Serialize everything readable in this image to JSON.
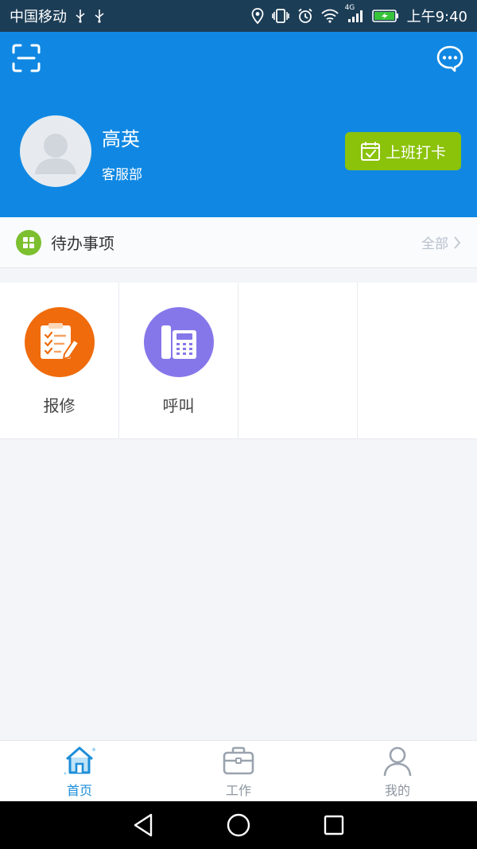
{
  "status_bar": {
    "carrier": "中国移动",
    "time": "上午9:40",
    "network_label": "4G"
  },
  "header": {
    "user_name": "高英",
    "department": "客服部",
    "clock_in_label": "上班打卡"
  },
  "todo": {
    "title": "待办事项",
    "all_label": "全部"
  },
  "grid": {
    "items": [
      {
        "label": "报修",
        "icon": "repair-clipboard-icon",
        "color": "#ef6b0c"
      },
      {
        "label": "呼叫",
        "icon": "telephone-icon",
        "color": "#8577ea"
      }
    ]
  },
  "tabbar": {
    "items": [
      {
        "label": "首页",
        "icon": "home-icon",
        "active": true
      },
      {
        "label": "工作",
        "icon": "briefcase-icon",
        "active": false
      },
      {
        "label": "我的",
        "icon": "user-icon",
        "active": false
      }
    ]
  },
  "colors": {
    "header_blue": "#1088e3",
    "clock_green": "#8bc20a",
    "todo_green": "#7cbf2f",
    "active_tab": "#1d8ed8"
  }
}
